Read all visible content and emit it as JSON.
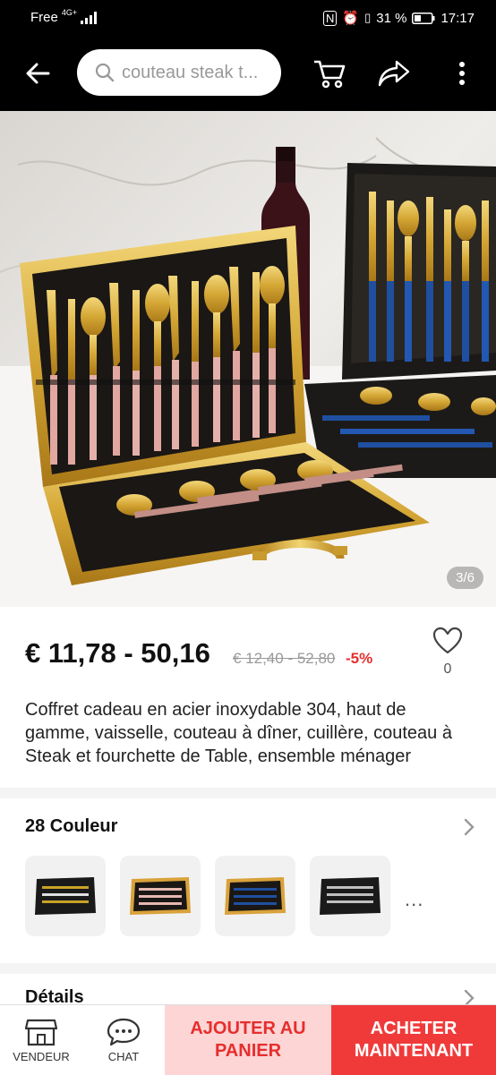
{
  "status_bar": {
    "carrier": "Free",
    "network": "4G+",
    "battery": "31 %",
    "time": "17:17"
  },
  "toolbar": {
    "search_text": "couteau steak t...",
    "icons": [
      "back-arrow-icon",
      "search-icon",
      "cart-icon",
      "share-icon",
      "more-vertical-icon"
    ]
  },
  "gallery": {
    "counter": "3/6"
  },
  "product": {
    "price": "€ 11,78 - 50,16",
    "old_price": "€ 12,40 - 52,80",
    "discount": "-5%",
    "wishlist_count": "0",
    "title": "Coffret cadeau en acier inoxydable 304, haut de gamme, vaisselle, couteau à dîner, cuillère, couteau à Steak et fourchette de Table, ensemble ménager"
  },
  "variants": {
    "heading": "28 Couleur",
    "more": "...",
    "swatches": [
      {
        "case": "#1a1a1a",
        "accent": "#c9a227"
      },
      {
        "case": "#d9a23a",
        "accent": "#e7b8b0"
      },
      {
        "case": "#d9a23a",
        "accent": "#1f4fa0"
      },
      {
        "case": "#1a1a1a",
        "accent": "#c0c0c0"
      }
    ]
  },
  "details": {
    "heading": "Détails"
  },
  "bottom_bar": {
    "vendor_label": "VENDEUR",
    "chat_label": "CHAT",
    "add_to_cart": "AJOUTER AU PANIER",
    "buy_now": "ACHETER MAINTENANT"
  },
  "colors": {
    "accent": "#e62e2e",
    "buy_button": "#f03a3a",
    "cart_button": "#fdd5d5"
  }
}
